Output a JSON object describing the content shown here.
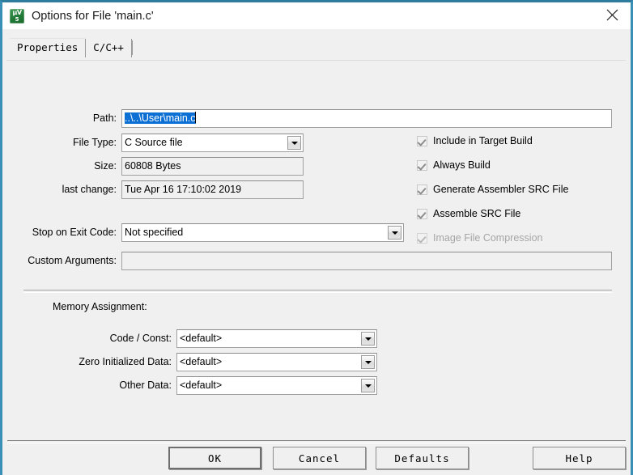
{
  "window": {
    "title": "Options for File 'main.c'",
    "icon": "uvision-logo-icon",
    "icon_line1": "µV",
    "icon_line2": "5",
    "close_label": "×",
    "accent_color": "#3a8fb7"
  },
  "tabs": [
    {
      "label": "Properties",
      "active": true
    },
    {
      "label": "C/C++",
      "active": false
    }
  ],
  "properties": {
    "path": {
      "label": "Path:",
      "value": "..\\..\\User\\main.c",
      "selected": true
    },
    "file_type": {
      "label": "File Type:",
      "value": "C Source file"
    },
    "size": {
      "label": "Size:",
      "value": "60808 Bytes"
    },
    "last_change": {
      "label": "last change:",
      "value": "Tue Apr 16 17:10:02 2019"
    },
    "stop_on_exit_code": {
      "label": "Stop on Exit Code:",
      "value": "Not specified"
    },
    "custom_arguments": {
      "label": "Custom Arguments:",
      "value": "",
      "placeholder": ""
    }
  },
  "options": [
    {
      "label": "Include in Target Build",
      "checked": true,
      "disabled": false
    },
    {
      "label": "Always Build",
      "checked": true,
      "disabled": false
    },
    {
      "label": "Generate Assembler SRC File",
      "checked": true,
      "disabled": false
    },
    {
      "label": "Assemble SRC File",
      "checked": true,
      "disabled": false
    },
    {
      "label": "Image File Compression",
      "checked": true,
      "disabled": true
    }
  ],
  "memory_assignment": {
    "title": "Memory Assignment:",
    "rows": [
      {
        "label": "Code / Const:",
        "value": "<default>"
      },
      {
        "label": "Zero Initialized Data:",
        "value": "<default>"
      },
      {
        "label": "Other Data:",
        "value": "<default>"
      }
    ]
  },
  "footer": {
    "ok": "OK",
    "cancel": "Cancel",
    "defaults": "Defaults",
    "help": "Help"
  }
}
